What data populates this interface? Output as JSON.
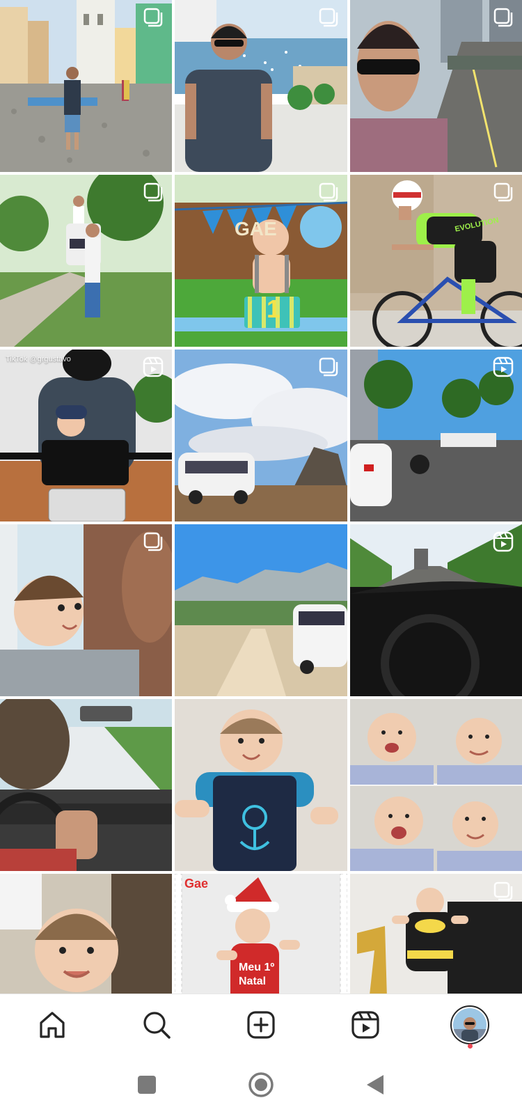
{
  "app": {
    "name": "Instagram profile grid"
  },
  "grid": {
    "tiles": [
      {
        "id": 1,
        "type": "carousel",
        "scene": "man standing on cobblestone street, colonial buildings"
      },
      {
        "id": 2,
        "type": "carousel",
        "scene": "man with sunglasses, harbor view with boats"
      },
      {
        "id": 3,
        "type": "carousel",
        "scene": "selfie with sunglasses on elevated road"
      },
      {
        "id": 4,
        "type": "carousel",
        "scene": "man lifting child near van, dirt road"
      },
      {
        "id": 5,
        "type": "carousel",
        "scene": "baby first birthday cake smash",
        "banner_text": "GAE",
        "cake_number": "1"
      },
      {
        "id": 6,
        "type": "carousel",
        "scene": "cyclist on road bike",
        "jersey_text": "EVOLUTION"
      },
      {
        "id": 7,
        "type": "reel",
        "scene": "man and baby on motorcycle",
        "caption": "TikTok @grgustavo"
      },
      {
        "id": 8,
        "type": "carousel",
        "scene": "white van under cloudy sky"
      },
      {
        "id": 9,
        "type": "reel",
        "scene": "street with palm trees and cars"
      },
      {
        "id": 10,
        "type": "carousel",
        "scene": "father and baby smiling"
      },
      {
        "id": 11,
        "type": "none",
        "scene": "white van on dirt road, mountains"
      },
      {
        "id": 12,
        "type": "reel",
        "scene": "driving on highway, dashboard view"
      },
      {
        "id": 13,
        "type": "none",
        "scene": "driving van, hand on steering wheel"
      },
      {
        "id": 14,
        "type": "none",
        "scene": "smiling baby in anchor overalls"
      },
      {
        "id": 15,
        "type": "none",
        "scene": "collage of four baby photos"
      },
      {
        "id": 16,
        "type": "none",
        "scene": "baby close-up smiling"
      },
      {
        "id": 17,
        "type": "none",
        "scene": "baby in santa hat",
        "corner_text": "Gae",
        "shirt_text": "Meu 1º Natal"
      },
      {
        "id": 18,
        "type": "carousel",
        "scene": "baby in batman outfit with gold number one balloon"
      }
    ]
  },
  "nav": {
    "items": [
      {
        "name": "home",
        "icon": "home-icon"
      },
      {
        "name": "search",
        "icon": "search-icon"
      },
      {
        "name": "create",
        "icon": "plus-square-icon"
      },
      {
        "name": "reels",
        "icon": "reels-icon"
      },
      {
        "name": "profile",
        "icon": "avatar",
        "has_notification": true
      }
    ]
  },
  "system_nav": {
    "items": [
      {
        "name": "recents",
        "icon": "square-icon"
      },
      {
        "name": "home",
        "icon": "circle-icon"
      },
      {
        "name": "back",
        "icon": "back-triangle-icon"
      }
    ]
  },
  "colors": {
    "notification": "#ed4956",
    "icon": "#262626",
    "system_icon": "#7a7a7a"
  }
}
